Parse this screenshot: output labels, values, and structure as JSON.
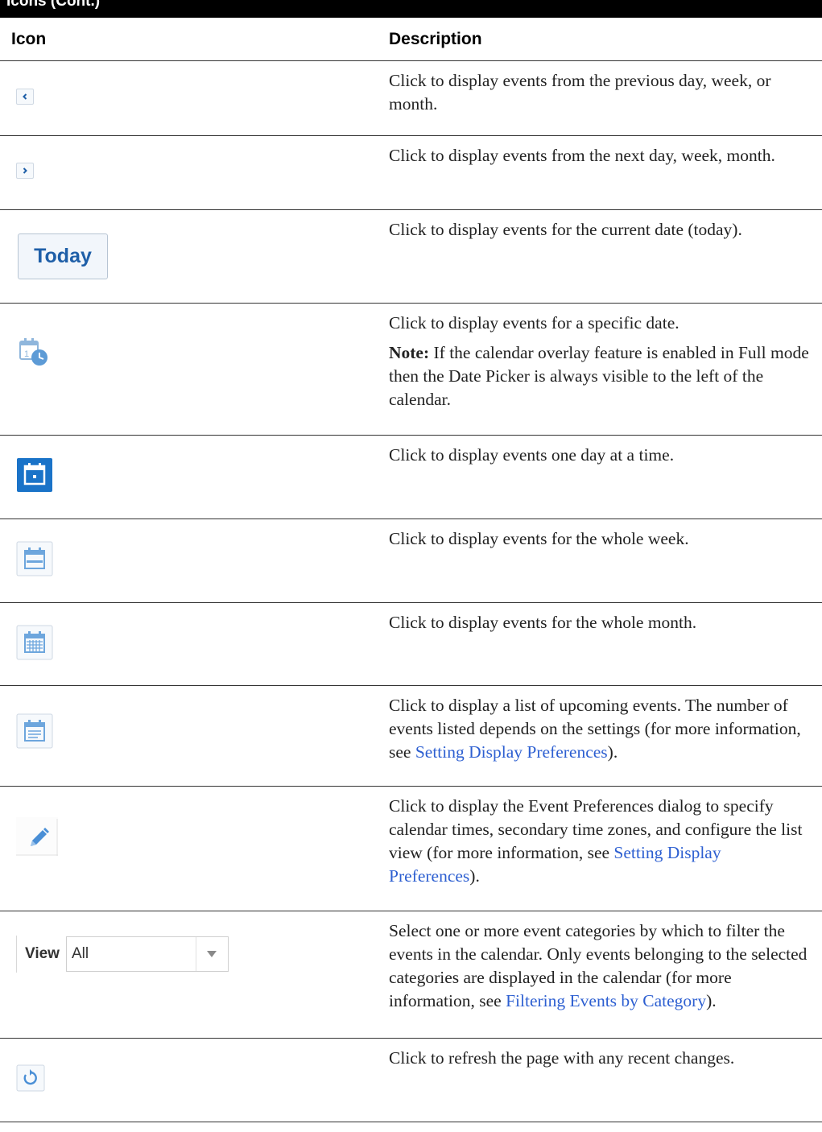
{
  "header": {
    "title": "Icons (Cont.)"
  },
  "table": {
    "col_icon": "Icon",
    "col_description": "Description"
  },
  "rows": [
    {
      "icon": "chevron-left-icon",
      "text": "Click to display events from the previous day, week, or month."
    },
    {
      "icon": "chevron-right-icon",
      "text": "Click to display events from the next day, week, month."
    },
    {
      "icon": "today-button",
      "button_label": "Today",
      "text": "Click to display events for the current date (today)."
    },
    {
      "icon": "date-picker-icon",
      "text": "Click to display events for a specific date.",
      "note_label": "Note:",
      "note_text": " If the calendar overlay feature is enabled in Full mode then the Date Picker is always visible to the left of the calendar."
    },
    {
      "icon": "day-view-icon",
      "text": "Click to display events one day at a time."
    },
    {
      "icon": "week-view-icon",
      "text": "Click to display events for the whole week."
    },
    {
      "icon": "month-view-icon",
      "text": "Click to display events for the whole month."
    },
    {
      "icon": "list-view-icon",
      "text_before": "Click to display a list of upcoming events. The number of events listed depends on the settings (for more information, see ",
      "link": "Setting Display Preferences",
      "text_after": ")."
    },
    {
      "icon": "pencil-icon",
      "text_before": "Click to display the Event Preferences dialog to specify calendar times, secondary time zones, and configure the list view (for more information, see ",
      "link": "Setting Display Preferences",
      "text_after": ")."
    },
    {
      "icon": "view-filter",
      "view_label": "View",
      "view_value": "All",
      "text_before": "Select one or more event categories by which to filter the events in the calendar. Only events belonging to the selected categories are displayed in the calendar (for more information, see ",
      "link": "Filtering Events by Category",
      "text_after": ")."
    },
    {
      "icon": "refresh-icon",
      "text": "Click to refresh the page with any recent changes."
    }
  ],
  "colors": {
    "link": "#2d5fd1",
    "icon_blue": "#1a73c8",
    "icon_light_blue": "#7fb2e0"
  }
}
